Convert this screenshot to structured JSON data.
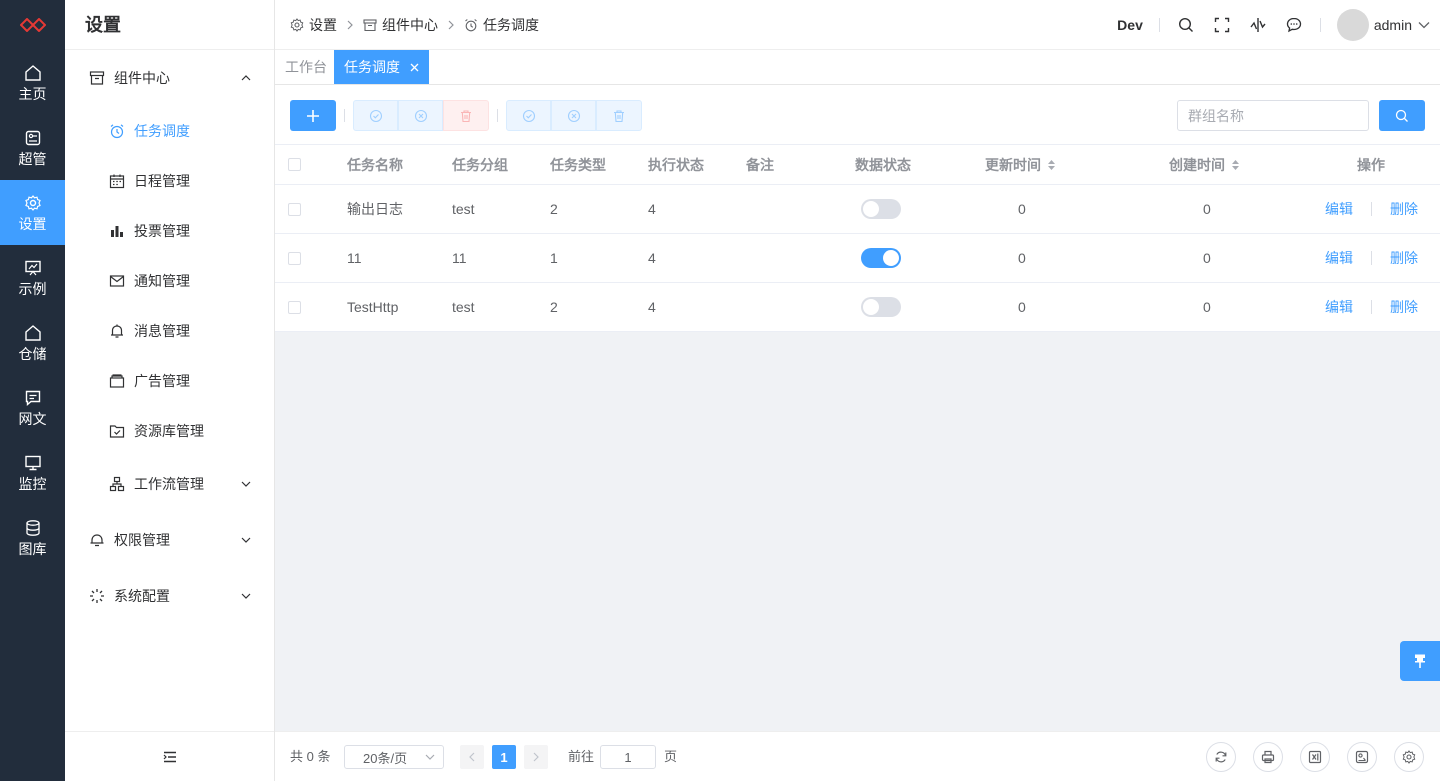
{
  "rail": {
    "items": [
      {
        "label": "主页",
        "icon": "home-icon"
      },
      {
        "label": "超管",
        "icon": "admin-icon"
      },
      {
        "label": "设置",
        "icon": "gear-icon"
      },
      {
        "label": "示例",
        "icon": "chart-board-icon"
      },
      {
        "label": "仓储",
        "icon": "warehouse-icon"
      },
      {
        "label": "网文",
        "icon": "message-icon"
      },
      {
        "label": "监控",
        "icon": "monitor-icon"
      },
      {
        "label": "图库",
        "icon": "database-icon"
      }
    ]
  },
  "sidebar": {
    "title": "设置",
    "group_components": "组件中心",
    "items": [
      {
        "label": "任务调度",
        "icon": "alarm-clock-icon"
      },
      {
        "label": "日程管理",
        "icon": "calendar-icon"
      },
      {
        "label": "投票管理",
        "icon": "bar-chart-icon"
      },
      {
        "label": "通知管理",
        "icon": "mail-icon"
      },
      {
        "label": "消息管理",
        "icon": "bell-icon"
      },
      {
        "label": "广告管理",
        "icon": "wallet-icon"
      },
      {
        "label": "资源库管理",
        "icon": "folder-check-icon"
      },
      {
        "label": "工作流管理",
        "icon": "workflow-icon"
      }
    ],
    "group_permissions": "权限管理",
    "group_system": "系统配置"
  },
  "header": {
    "breadcrumb": [
      "设置",
      "组件中心",
      "任务调度"
    ],
    "env": "Dev",
    "user": "admin"
  },
  "tabs": {
    "workbench": "工作台",
    "active": "任务调度"
  },
  "toolbar": {
    "search_placeholder": "群组名称"
  },
  "table": {
    "headers": {
      "name": "任务名称",
      "group": "任务分组",
      "type": "任务类型",
      "exec_status": "执行状态",
      "remark": "备注",
      "data_status": "数据状态",
      "updated": "更新时间",
      "created": "创建时间",
      "actions": "操作"
    },
    "edit_label": "编辑",
    "delete_label": "删除",
    "rows": [
      {
        "name": "输出日志",
        "group": "test",
        "type": "2",
        "exec_status": "4",
        "remark": "",
        "enabled": false,
        "updated": "0",
        "created": "0"
      },
      {
        "name": "11",
        "group": "11",
        "type": "1",
        "exec_status": "4",
        "remark": "",
        "enabled": true,
        "updated": "0",
        "created": "0"
      },
      {
        "name": "TestHttp",
        "group": "test",
        "type": "2",
        "exec_status": "4",
        "remark": "",
        "enabled": false,
        "updated": "0",
        "created": "0"
      }
    ]
  },
  "pagination": {
    "total": "共 0 条",
    "page_size": "20条/页",
    "current_page": "1",
    "goto_label": "前往",
    "goto_value": "1",
    "page_unit": "页"
  },
  "colors": {
    "primary": "#409eff",
    "rail_bg": "#222d3c"
  }
}
